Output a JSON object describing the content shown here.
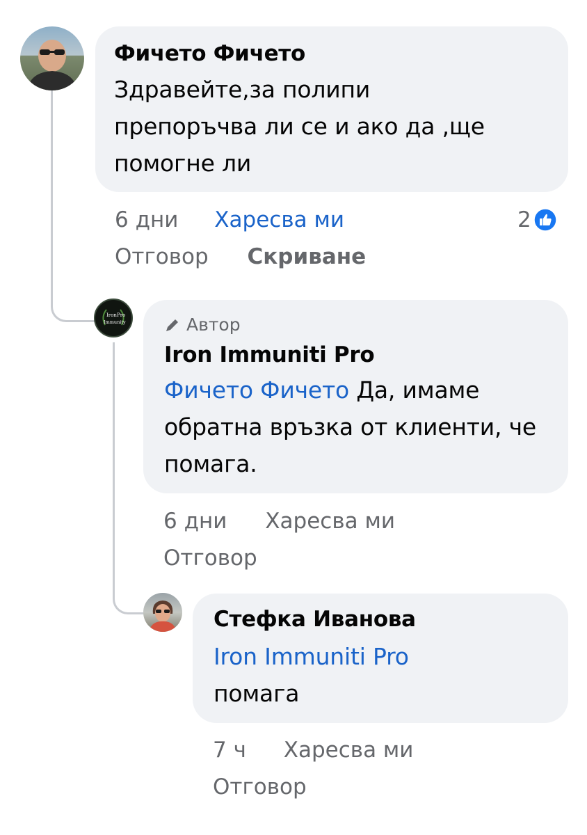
{
  "comment": {
    "author": "Фичето Фичето",
    "text": "Здравейте,за полипи препоръчва ли се и ако да ,ще помогне ли",
    "time": "6 дни",
    "like_label": "Харесва ми",
    "reaction_count": "2",
    "reply_label": "Отговор",
    "hide_label": "Скриване"
  },
  "reply1": {
    "badge": "Автор",
    "author": "Iron Immuniti Pro",
    "avatar_lines": [
      "Iron",
      "Pro",
      "Immunity"
    ],
    "mention": "Фичето Фичето",
    "text": " Да, имаме обратна връзка от клиенти, че помага.",
    "time": "6 дни",
    "like_label": "Харесва ми",
    "reply_label": "Отговор"
  },
  "reply2": {
    "author": "Стефка Иванова",
    "mention": "Iron Immuniti Pro",
    "text": "помага",
    "time": "7 ч",
    "like_label": "Харесва ми",
    "reply_label": "Отговор"
  },
  "colors": {
    "bubble": "#f0f2f5",
    "link_blue": "#1a63c9",
    "meta_gray": "#65676b",
    "like_badge": "#1877f2"
  },
  "icons": [
    "like-reaction-icon",
    "pencil-icon"
  ]
}
